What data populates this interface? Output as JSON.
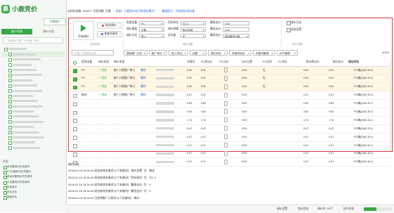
{
  "app": {
    "name": "小鹿竞价",
    "download_label": "下载账户",
    "info_text": "支持任务数: 0/100个    可竞词数: 不限",
    "info_link1": "帮助：小鹿竞价有几种调价模式？",
    "info_link2": "重要提示！开始前必须检查..."
  },
  "sidebar": {
    "tabs": [
      "账户列表",
      "调价分类"
    ],
    "search_placeholder": "搜索账户/推广计划/推广单元",
    "tree_rows": 20,
    "log_header": "消息",
    "log_items": [
      "未设置竞价的关键词",
      "PC设置竞价的关键词",
      "移动设置竞价的关键词",
      "已设置竞价的关键词",
      "批量竞价",
      "排名优化",
      "高级优化"
    ]
  },
  "controls": {
    "start_button": "开始调价",
    "stop_button": "取消调价",
    "reset_button": "恢复关键词",
    "group1_label": "任务控制",
    "bid_device_label": "投放设备",
    "bid_device_value": "PC",
    "adjust_speed_label": "调价速度",
    "adjust_speed_value": "平衡",
    "mode_label": "调价方式",
    "mode_value": "导入",
    "target_label": "目标排名",
    "target_value": "左1-2",
    "region_label": "调价地域",
    "region_value": "默认地域",
    "priority_label": "优先级",
    "priority_value": "中",
    "max_bid_label": "最高出价",
    "max_bid_value": "0.30",
    "min_bid_label": "最低出价",
    "min_bid_value": "0.30",
    "after_label": "最高出价",
    "after_value": "保持最低价格",
    "group2_label": "调价设置",
    "opt1": "调价日志",
    "opt2": "全局设置",
    "group3_label": "用户设置"
  },
  "filter": {
    "search_placeholder": "已输入关键词/后缀",
    "f1": "搜索推广计划",
    "f2": "推广单元",
    "f3": "导入/导出",
    "f4": "设置",
    "f5": "调价状态",
    "f6": "关键词状态",
    "f7": "关键词管理",
    "f8": "APP管理",
    "page_count": "3/102"
  },
  "table": {
    "headers": [
      "投放设备",
      "调价状态",
      "调价申请",
      "",
      "关键词",
      "PC原出价",
      "PC出价",
      "出价位置",
      "PC比例",
      "PC排名",
      "移动原出价",
      "移动出价",
      "移动排名",
      "调价方式"
    ],
    "rows": [
      {
        "checked": true,
        "hl": true,
        "device": "PC",
        "status": "✓ 完成",
        "plan": "推广计划推广单元",
        "op": "删除",
        "orig": "5.30",
        "bid": "5.30",
        "ratio": "10%",
        "rank": "无",
        "m_orig": "0.53",
        "m_bid": "0.53",
        "m_rank": "",
        "mode": "PC端(2)K0.30-4"
      },
      {
        "checked": true,
        "hl": true,
        "device": "PC",
        "status": "✓ 完成",
        "plan": "推广计划推广单元",
        "op": "删除",
        "orig": "5.30",
        "bid": "5.30",
        "ratio": "10%",
        "rank": "无",
        "m_orig": "0.53",
        "m_bid": "0.53",
        "m_rank": "",
        "mode": "PC端(2)K0.30-4"
      },
      {
        "checked": true,
        "hl": true,
        "device": "PC",
        "status": "✓ 完成",
        "plan": "推广计划推广单元",
        "op": "删除",
        "orig": "5.30",
        "bid": "5.30",
        "ratio": "10%",
        "rank": "无",
        "m_orig": "0.56",
        "m_bid": "0.53",
        "m_rank": "",
        "mode": "PC端(2)K0.30-4"
      },
      {
        "checked": false,
        "hl": false,
        "device": "移动",
        "status": "✓ 完成",
        "plan": "推广计划推广单元",
        "op": "删除",
        "orig": "0.47",
        "bid": "0.47",
        "ratio": "10%",
        "rank": "",
        "m_orig": "0.47",
        "m_bid": "0.47",
        "m_rank": "",
        "mode": "PC端(2)K0.30-4"
      },
      {
        "checked": false,
        "hl": false,
        "device": "-",
        "status": "-",
        "plan": "-",
        "op": "",
        "orig": "0.89",
        "bid": "0.89",
        "ratio": "10%",
        "rank": "",
        "m_orig": "0.89",
        "m_bid": "0.89",
        "m_rank": "",
        "mode": "PC端(2)K0.30-4"
      },
      {
        "checked": false,
        "hl": false,
        "device": "-",
        "status": "-",
        "plan": "-",
        "op": "",
        "orig": "3.50",
        "bid": "3.50",
        "ratio": "10%",
        "rank": "",
        "m_orig": "3.50",
        "m_bid": "3.50",
        "m_rank": "",
        "mode": "PC端(2)K0.30-4"
      },
      {
        "checked": false,
        "hl": false,
        "device": "-",
        "status": "-",
        "plan": "-",
        "op": "",
        "orig": "1.74",
        "bid": "1.74",
        "ratio": "10%",
        "rank": "",
        "m_orig": "1.74",
        "m_bid": "1.74",
        "m_rank": "",
        "mode": "PC端(2)K0.30-4"
      },
      {
        "checked": false,
        "hl": false,
        "device": "-",
        "status": "-",
        "plan": "-",
        "op": "",
        "orig": "0.47",
        "bid": "0.47",
        "ratio": "10%",
        "rank": "",
        "m_orig": "0.47",
        "m_bid": "0.47",
        "m_rank": "",
        "mode": "PC端(2)K0.30-4"
      },
      {
        "checked": false,
        "hl": false,
        "device": "-",
        "status": "-",
        "plan": "-",
        "op": "",
        "orig": "0.47",
        "bid": "0.47",
        "ratio": "10%",
        "rank": "",
        "m_orig": "0.47",
        "m_bid": "0.47",
        "m_rank": "",
        "mode": "PC端(2)K0.30-4"
      },
      {
        "checked": false,
        "hl": false,
        "device": "-",
        "status": "-",
        "plan": "-",
        "op": "",
        "orig": "0.47",
        "bid": "0.47",
        "ratio": "10%",
        "rank": "",
        "m_orig": "0.47",
        "m_bid": "0.47",
        "m_rank": "",
        "mode": "PC端(2)K0.30-4"
      },
      {
        "checked": false,
        "hl": false,
        "device": "-",
        "status": "-",
        "plan": "-",
        "op": "",
        "orig": "0.47",
        "bid": "0.47",
        "ratio": "10%",
        "rank": "",
        "m_orig": "0.47",
        "m_bid": "0.47",
        "m_rank": "",
        "mode": "PC端(2)K0.30-4"
      },
      {
        "checked": false,
        "hl": false,
        "device": "-",
        "status": "-",
        "plan": "-",
        "op": "",
        "orig": "0.47",
        "bid": "0.47",
        "ratio": "10%",
        "rank": "",
        "m_orig": "0.47",
        "m_bid": "0.47",
        "m_rank": "",
        "mode": "PC端(2)K0.30-4"
      }
    ]
  },
  "log": {
    "title": "调价日志",
    "lines": [
      "2018-01-16 15:34:42 成功修改关键词\"[1个关键词]\" \"调价设置\" 为：移动",
      "2018-01-16 15:34:43 成功修改关键词\"[1个关键词]\" \"目标排名\" 为：左1-2",
      "2018-01-16 15:34:43 成功修改关键词\"[1个关键词]\" \"最高出价\" 为：5",
      "2018-01-16 15:34:44 成功修改关键词\"[1个关键词]\" \"最低出价\" 为：5",
      "2018-01-16 15:34:44 已修改推广计划对\"[1个关键词]\" \"调价\""
    ]
  },
  "status": {
    "s1": "调价设置",
    "s2": "竞价状态",
    "s3": "调价中: 0/0个",
    "s4": "执行状态",
    "progress": 0.45
  }
}
